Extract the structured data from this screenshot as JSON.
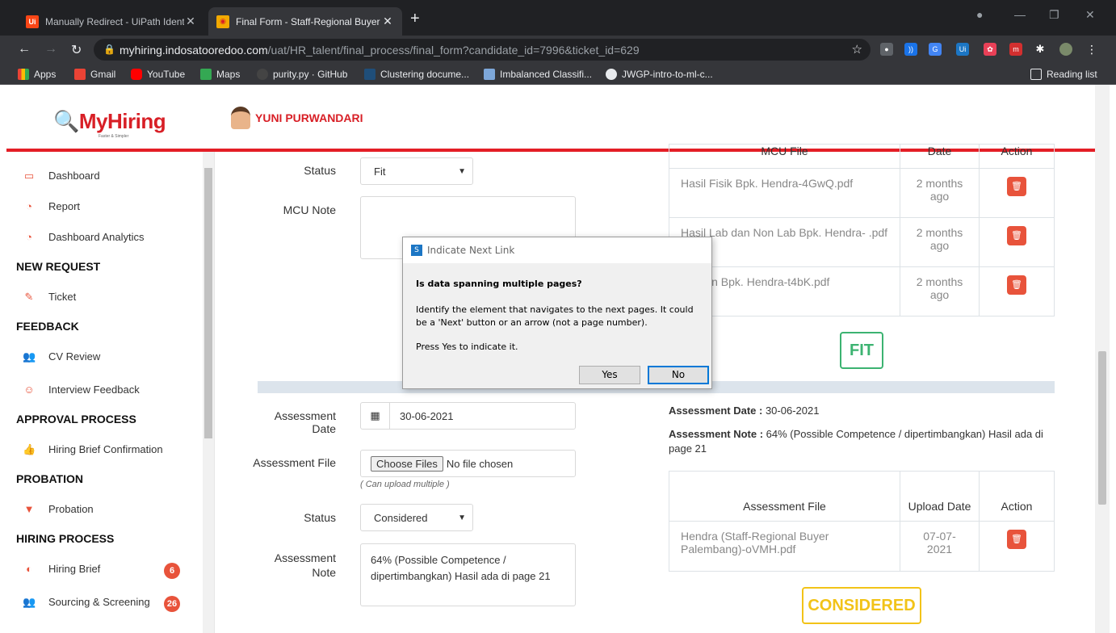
{
  "browser": {
    "tabs": [
      {
        "title": "Manually Redirect - UiPath Identi"
      },
      {
        "title": "Final Form - Staff-Regional Buyer"
      }
    ],
    "url_domain": "myhiring.indosatooredoo.com",
    "url_path": "/uat/HR_talent/final_process/final_form?candidate_id=7996&ticket_id=629",
    "bookmarks": [
      "Apps",
      "Gmail",
      "YouTube",
      "Maps",
      "purity.py · GitHub",
      "Clustering docume...",
      "Imbalanced Classifi...",
      "JWGP-intro-to-ml-c..."
    ],
    "reading_list": "Reading list"
  },
  "app": {
    "logo": "MyHiring",
    "logo_tagline": "Faster & Simpler",
    "user_name": "YUNI PURWANDARI"
  },
  "sidebar": {
    "items": [
      {
        "label": "Dashboard",
        "icon": "dashboard-icon"
      },
      {
        "label": "Report",
        "icon": "gauge-icon"
      },
      {
        "label": "Dashboard Analytics",
        "icon": "gauge-icon"
      }
    ],
    "sections": [
      {
        "heading": "NEW REQUEST",
        "items": [
          {
            "label": "Ticket"
          }
        ]
      },
      {
        "heading": "FEEDBACK",
        "items": [
          {
            "label": "CV Review"
          },
          {
            "label": "Interview Feedback"
          }
        ]
      },
      {
        "heading": "APPROVAL PROCESS",
        "items": [
          {
            "label": "Hiring Brief Confirmation"
          }
        ]
      },
      {
        "heading": "PROBATION",
        "items": [
          {
            "label": "Probation"
          }
        ]
      },
      {
        "heading": "HIRING PROCESS",
        "items": [
          {
            "label": "Hiring Brief",
            "badge": "6"
          },
          {
            "label": "Sourcing & Screening",
            "badge": "26"
          }
        ]
      }
    ]
  },
  "mcu_form": {
    "status_label": "Status",
    "status_value": "Fit",
    "note_label": "MCU Note"
  },
  "mcu_table": {
    "header": [
      "MCU File",
      "Date",
      "Action"
    ],
    "rows": [
      {
        "file": "Hasil Fisik Bpk. Hendra-4GwQ.pdf",
        "date": "2 months ago"
      },
      {
        "file": "Hasil Lab dan Non Lab Bpk. Hendra-      .pdf",
        "date": "2 months ago"
      },
      {
        "file": "mpulan Bpk. Hendra-t4bK.pdf",
        "date": "2 months ago"
      }
    ],
    "stamp": "FIT"
  },
  "assessment_form": {
    "date_label": "Assessment Date",
    "date_value": "30-06-2021",
    "file_label": "Assessment File",
    "choose_files": "Choose Files",
    "no_file": "No file chosen",
    "upload_hint": "( Can upload multiple )",
    "status_label": "Status",
    "status_value": "Considered",
    "note_label": "Assessment Note",
    "note_value": "64% (Possible Competence / dipertimbangkan) Hasil ada di page 21"
  },
  "assessment_info": {
    "date_key": "Assessment Date :",
    "date_val": "30-06-2021",
    "note_key": "Assessment Note :",
    "note_val": "64% (Possible Competence / dipertimbangkan) Hasil ada di page 21"
  },
  "assessment_table": {
    "header": [
      "Assessment File",
      "Upload Date",
      "Action"
    ],
    "rows": [
      {
        "file": "Hendra (Staff-Regional Buyer Palembang)-oVMH.pdf",
        "date": "07-07-2021"
      }
    ],
    "stamp": "CONSIDERED"
  },
  "dialog": {
    "title": "Indicate Next Link",
    "question": "Is data spanning multiple pages?",
    "body": "Identify the element that navigates to the next pages. It could be a 'Next' button or an arrow (not a page number).",
    "prompt": "Press Yes to indicate it.",
    "yes": "Yes",
    "no": "No"
  }
}
